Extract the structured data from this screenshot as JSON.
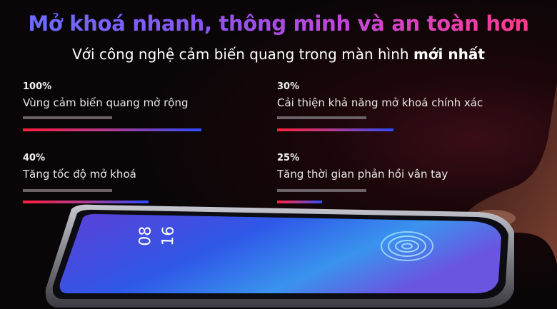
{
  "banner": {
    "headline": "Mở khoá nhanh, thông minh và an toàn hơn",
    "subhead_prefix": "Với công nghệ cảm biến quang trong màn hình ",
    "subhead_bold": "mới nhất"
  },
  "stats": [
    {
      "percent_label": "100%",
      "value": 1.0,
      "label": "Vùng cảm biến quang mở rộng"
    },
    {
      "percent_label": "30%",
      "value": 0.3,
      "label": "Cải thiện khả năng mở khoá chính xác"
    },
    {
      "percent_label": "40%",
      "value": 0.4,
      "label": "Tăng tốc độ mở khoá"
    },
    {
      "percent_label": "25%",
      "value": 0.25,
      "label": "Tăng thời gian phản hồi vân tay"
    }
  ],
  "phone_screen": {
    "clock_hour": "08",
    "clock_minute": "16"
  },
  "colors": {
    "headline_gradient_start": "#6a6cff",
    "headline_gradient_end": "#ff3a8e",
    "bar_gradient_start": "#ff1e3c",
    "bar_gradient_end": "#2c4dff",
    "track": "#6a6266"
  }
}
